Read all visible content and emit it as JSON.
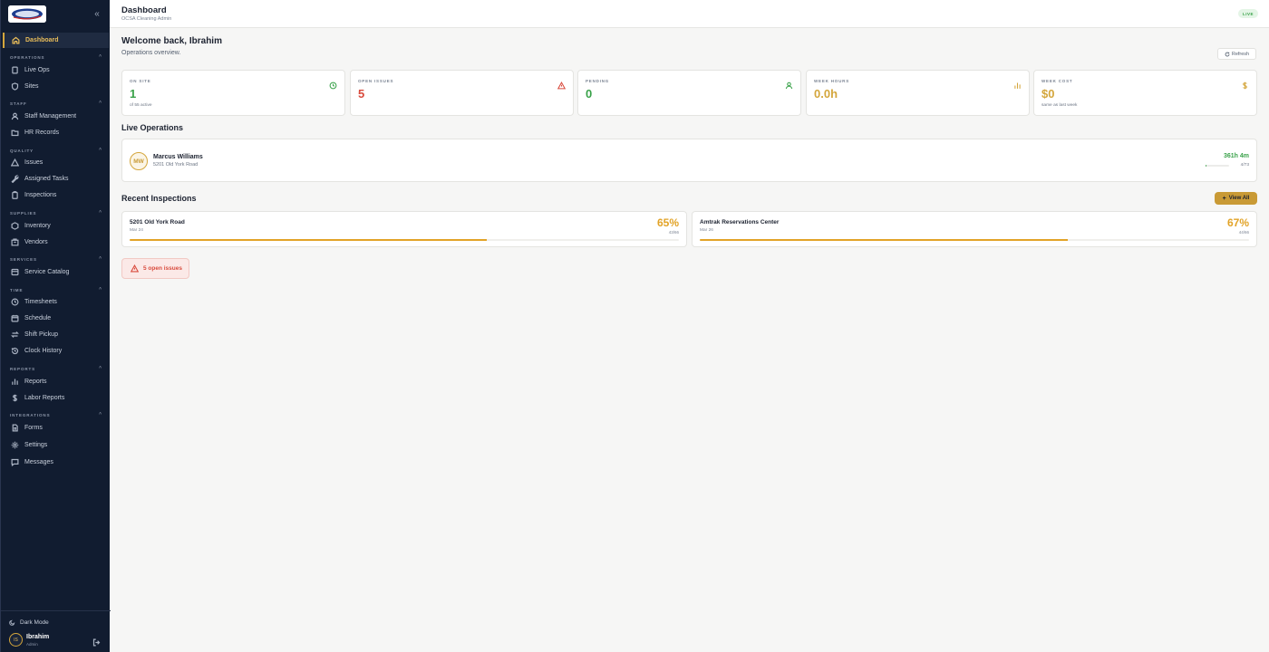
{
  "sidebar": {
    "collapse_icon": "chevrons-left-icon",
    "active": {
      "label": "Dashboard",
      "icon": "home-icon"
    },
    "sections": [
      {
        "title": "OPERATIONS",
        "items": [
          {
            "label": "Live Ops",
            "icon": "tablet-icon"
          },
          {
            "label": "Sites",
            "icon": "shield-icon"
          }
        ]
      },
      {
        "title": "STAFF",
        "items": [
          {
            "label": "Staff Management",
            "icon": "user-icon"
          },
          {
            "label": "HR Records",
            "icon": "folder-icon"
          }
        ]
      },
      {
        "title": "QUALITY",
        "items": [
          {
            "label": "Issues",
            "icon": "warning-icon"
          },
          {
            "label": "Assigned Tasks",
            "icon": "wrench-icon"
          },
          {
            "label": "Inspections",
            "icon": "clipboard-icon"
          }
        ]
      },
      {
        "title": "SUPPLIES",
        "items": [
          {
            "label": "Inventory",
            "icon": "box-icon"
          },
          {
            "label": "Vendors",
            "icon": "building-icon"
          }
        ]
      },
      {
        "title": "SERVICES",
        "items": [
          {
            "label": "Service Catalog",
            "icon": "grid-icon"
          }
        ]
      },
      {
        "title": "TIME",
        "items": [
          {
            "label": "Timesheets",
            "icon": "clock-icon"
          },
          {
            "label": "Schedule",
            "icon": "calendar-icon"
          },
          {
            "label": "Shift Pickup",
            "icon": "swap-icon"
          },
          {
            "label": "Clock History",
            "icon": "history-icon"
          }
        ]
      },
      {
        "title": "REPORTS",
        "items": [
          {
            "label": "Reports",
            "icon": "bar-chart-icon"
          },
          {
            "label": "Labor Reports",
            "icon": "dollar-icon"
          }
        ]
      },
      {
        "title": "INTEGRATIONS",
        "items": [
          {
            "label": "Forms",
            "icon": "document-icon"
          },
          {
            "label": "Settings",
            "icon": "gear-icon"
          },
          {
            "label": "Messages",
            "icon": "message-icon"
          }
        ]
      }
    ],
    "dark_mode": "Dark Mode",
    "user": {
      "initials": "IS",
      "name": "Ibrahim",
      "role": "Admin"
    }
  },
  "header": {
    "title": "Dashboard",
    "subtitle": "OCSA Cleaning Admin",
    "badge": "LIVE"
  },
  "main": {
    "welcome": "Welcome back, Ibrahim",
    "overview": "Operations overview.",
    "refresh": "Refresh",
    "stats": [
      {
        "label": "ON SITE",
        "value": "1",
        "note": "of 55 active",
        "color": "#3aa24a",
        "icon": "clock-icon"
      },
      {
        "label": "OPEN ISSUES",
        "value": "5",
        "note": "",
        "color": "#d94b3d",
        "icon": "warning-icon"
      },
      {
        "label": "PENDING",
        "value": "0",
        "note": "",
        "color": "#3aa24a",
        "icon": "user-icon"
      },
      {
        "label": "WEEK HOURS",
        "value": "0.0h",
        "note": "",
        "color": "#d4a63c",
        "icon": "bar-chart-icon"
      },
      {
        "label": "WEEK COST",
        "value": "$0",
        "note": "same as last week",
        "color": "#d4a63c",
        "icon": "dollar-icon"
      }
    ],
    "live_title": "Live Operations",
    "live": {
      "initials": "MW",
      "name": "Marcus Williams",
      "address": "5201 Old York Road",
      "duration": "361h 4m",
      "progress_label": "4/73",
      "progress": 0.055
    },
    "recent_title": "Recent Inspections",
    "view_all": "View All",
    "inspections": [
      {
        "name": "5201 Old York Road",
        "date": "Mar 24",
        "percent": "65%",
        "score": "43/66",
        "progress": 0.65
      },
      {
        "name": "Amtrak Reservations Center",
        "date": "Mar 26",
        "percent": "67%",
        "score": "44/66",
        "progress": 0.67
      }
    ],
    "alert": "5 open issues"
  }
}
